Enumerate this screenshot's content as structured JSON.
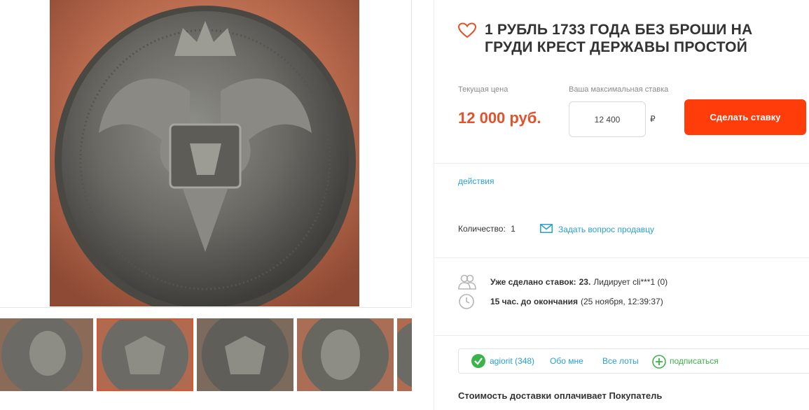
{
  "lot": {
    "title": "1 РУБЛЬ 1733 ГОДА БЕЗ БРОШИ НА ГРУДИ КРЕСТ ДЕРЖАВЫ ПРОСТОЙ"
  },
  "pricing": {
    "current_label": "Текущая цена",
    "current_value": "12 000 руб.",
    "max_bid_label": "Ваша максимальная ставка",
    "max_bid_value": "12 400",
    "currency": "₽",
    "bid_button": "Сделать ставку"
  },
  "actions": {
    "label": "действия"
  },
  "quantity": {
    "label": "Количество:",
    "value": "1"
  },
  "ask_seller": {
    "label": "Задать вопрос продавцу"
  },
  "stats": {
    "bids_label": "Уже сделано ставок:",
    "bids_count": "23.",
    "leader_text": "Лидирует cli***1 (0)",
    "time_left": "15 час. до окончания",
    "end_date": "(25 ноября, 12:39:37)"
  },
  "seller": {
    "name": "agiorit (348)",
    "about": "Обо мне",
    "all_lots": "Все лоты",
    "subscribe": "подписаться"
  },
  "shipping": {
    "text": "Стоимость доставки оплачивает Покупатель"
  },
  "colors": {
    "accent": "#ff3d0a",
    "price": "#e2522b",
    "link": "#2aa0d2",
    "verified": "#3cb34a"
  },
  "icons": [
    "heart-icon",
    "envelope-icon",
    "users-icon",
    "clock-icon",
    "check-circle-icon",
    "plus-circle-icon"
  ]
}
